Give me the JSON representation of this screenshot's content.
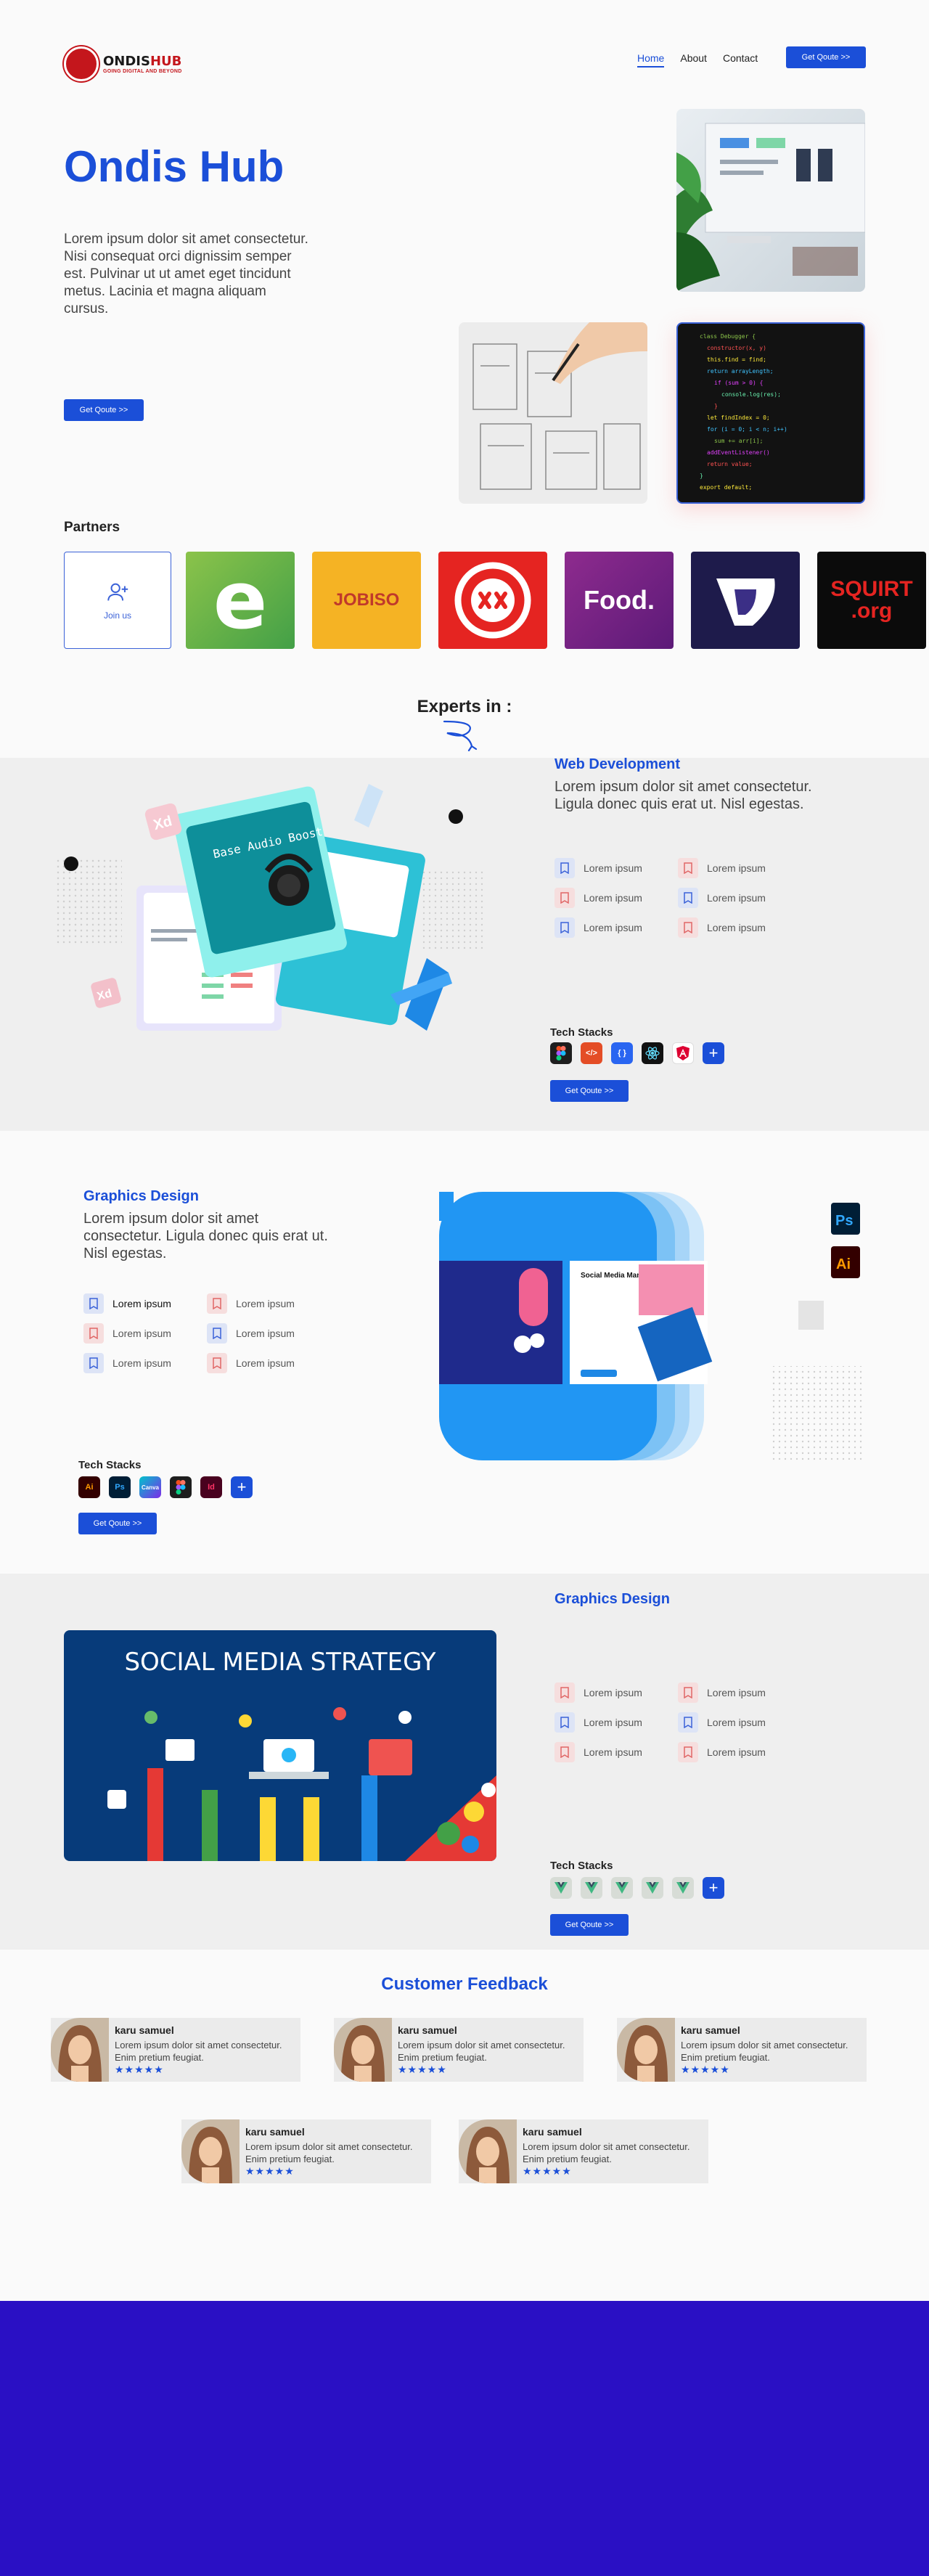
{
  "header": {
    "logo_name_a": "ONDIS",
    "logo_name_b": "HUB",
    "logo_tag": "GOING DIGITAL AND BEYOND",
    "nav": [
      "Home",
      "About",
      "Contact"
    ],
    "cta": "Get Qoute >>"
  },
  "hero": {
    "title": "Ondis Hub",
    "text": "Lorem ipsum dolor sit amet consectetur. Nisi consequat orci dignissim semper est. Pulvinar ut ut amet eget tincidunt metus. Lacinia et magna aliquam cursus.",
    "cta": "Get Qoute >>"
  },
  "partners": {
    "title": "Partners",
    "join": "Join us",
    "logos": [
      "e",
      "JOBISO",
      "xx",
      "Food.",
      "D",
      "SQUIRT .org"
    ]
  },
  "experts": {
    "title": "Experts in :"
  },
  "web": {
    "title": "Web Development",
    "text": "Lorem ipsum dolor sit amet consectetur. Ligula donec quis erat ut. Nisl egestas.",
    "features": [
      "Lorem ipsum",
      "Lorem ipsum",
      "Lorem ipsum",
      "Lorem ipsum",
      "Lorem ipsum",
      "Lorem ipsum"
    ],
    "stack_title": "Tech Stacks",
    "cta": "Get Qoute >>",
    "illustration_text": "Base Audio Boost"
  },
  "graphics": {
    "title": "Graphics Design",
    "text": "Lorem ipsum dolor sit amet consectetur. Ligula donec quis erat ut. Nisl egestas.",
    "features": [
      "Lorem ipsum",
      "Lorem ipsum",
      "Lorem ipsum",
      "Lorem ipsum",
      "Lorem ipsum",
      "Lorem ipsum"
    ],
    "stack_title": "Tech Stacks",
    "stack": [
      "Ai",
      "Ps",
      "Canva",
      "",
      "Id"
    ],
    "cta": "Get Qoute >>",
    "mock_title": "Social Media Manager"
  },
  "graphics2": {
    "title": "Graphics Design",
    "banner": "SOCIAL MEDIA STRATEGY",
    "features": [
      "Lorem ipsum",
      "Lorem ipsum",
      "Lorem ipsum",
      "Lorem ipsum",
      "Lorem ipsum",
      "Lorem ipsum"
    ],
    "stack_title": "Tech Stacks",
    "cta": "Get Qoute >>"
  },
  "feedback": {
    "title": "Customer Feedback",
    "items": [
      {
        "name": "karu samuel",
        "text": "Lorem ipsum dolor sit amet consectetur. Enim pretium feugiat.",
        "stars": "★★★★★"
      },
      {
        "name": "karu samuel",
        "text": "Lorem ipsum dolor sit amet consectetur. Enim pretium feugiat.",
        "stars": "★★★★★"
      },
      {
        "name": "karu samuel",
        "text": "Lorem ipsum dolor sit amet consectetur. Enim pretium feugiat.",
        "stars": "★★★★★"
      },
      {
        "name": "karu samuel",
        "text": "Lorem ipsum dolor sit amet consectetur. Enim pretium feugiat.",
        "stars": "★★★★★"
      },
      {
        "name": "karu samuel",
        "text": "Lorem ipsum dolor sit amet consectetur. Enim pretium feugiat.",
        "stars": "★★★★★"
      }
    ]
  },
  "colors": {
    "brand": "#1b4fd8",
    "footer": "#2a10c4",
    "logo_red": "#c4161c"
  }
}
